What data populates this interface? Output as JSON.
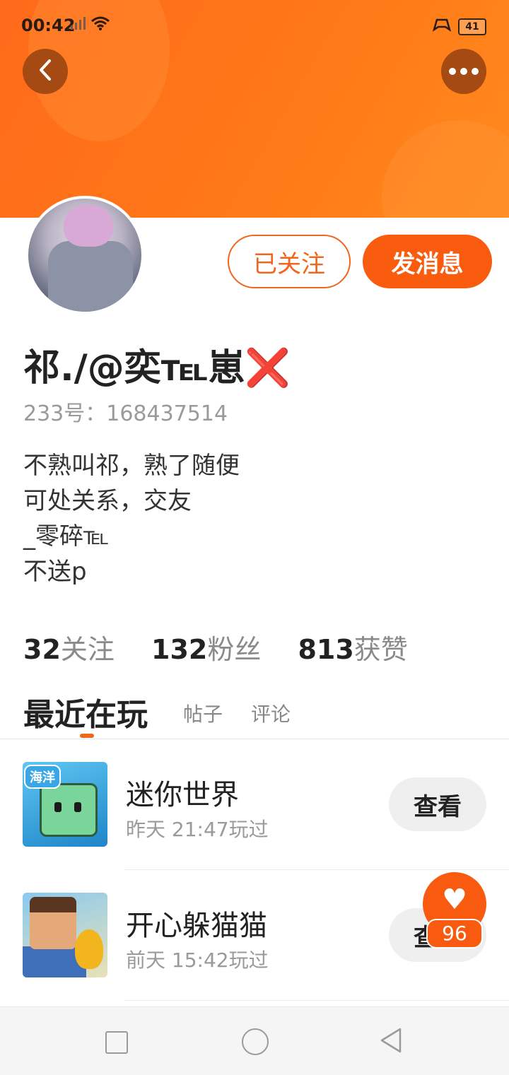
{
  "status_bar": {
    "time": "00:42",
    "signal_icon": "signal-x-icon",
    "wifi_icon": "wifi-icon",
    "right_icon": "gamepad-icon",
    "battery": "41"
  },
  "header": {
    "back_icon": "chevron-left-icon",
    "more_icon": "more-dots-icon",
    "background_color": "#ff7a18"
  },
  "profile": {
    "follow_label": "已关注",
    "message_label": "发消息",
    "username": "祁./@奕℡崽❌",
    "id_line": "233号：168437514",
    "bio": [
      "不熟叫祁，熟了随便",
      "可处关系，交友",
      "_零碎℡",
      "不送p"
    ]
  },
  "stats": [
    {
      "num": "32",
      "label": "关注"
    },
    {
      "num": "132",
      "label": "粉丝"
    },
    {
      "num": "813",
      "label": "获赞"
    }
  ],
  "tabs": {
    "active": "最近在玩",
    "posts": "帖子",
    "comments": "评论"
  },
  "games": [
    {
      "name": "迷你世界",
      "time": "昨天 21:47玩过",
      "button": "查看",
      "icon_tag": "海洋"
    },
    {
      "name": "开心躲猫猫",
      "time": "前天 15:42玩过",
      "button": "查看"
    }
  ],
  "like": {
    "count": "96",
    "icon": "heart-icon"
  },
  "accent_color": "#f95b0f"
}
